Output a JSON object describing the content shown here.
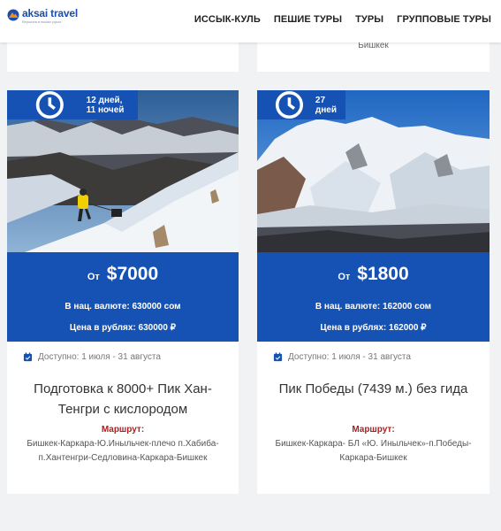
{
  "header": {
    "logo_name": "aksai travel",
    "logo_tagline": "Вершина в ваших руках",
    "nav": [
      "ИССЫК-КУЛЬ",
      "ПЕШИЕ ТУРЫ",
      "ТУРЫ",
      "ГРУППОВЫЕ ТУРЫ"
    ]
  },
  "prev_cards": [
    {
      "text": ""
    },
    {
      "text": "Бишкек"
    }
  ],
  "tours": [
    {
      "duration": "12 дней, 11 ночей",
      "price_from": "От",
      "price": "$7000",
      "price_local": "В нац. валюте: 630000 сом",
      "price_rub": "Цена в рублях: 630000 ₽",
      "availability": "Доступно: 1 июля - 31 августа",
      "title": "Подготовка к 8000+ Пик Хан-Тенгри с кислородом",
      "route_label": "Маршрут:",
      "route": "Бишкек-Каркара-Ю.Иныльчек-плечо п.Хабиба-п.Хантенгри-Седловина-Каркара-Бишкек"
    },
    {
      "duration": "27 дней",
      "price_from": "От",
      "price": "$1800",
      "price_local": "В нац. валюте: 162000 сом",
      "price_rub": "Цена в рублях: 162000 ₽",
      "availability": "Доступно: 1 июля - 31 августа",
      "title": "Пик Победы (7439 м.) без гида",
      "route_label": "Маршрут:",
      "route": "Бишкек-Каркара- БЛ «Ю. Иныльчек»-п.Победы-Каркара-Бишкек"
    }
  ],
  "icons": {
    "clock": "clock-icon",
    "calendar": "calendar-check-icon",
    "logo": "logo-mark-icon"
  },
  "colors": {
    "accent": "#1552b4",
    "route_label": "#b11c1c",
    "background": "#f1f2f4"
  }
}
